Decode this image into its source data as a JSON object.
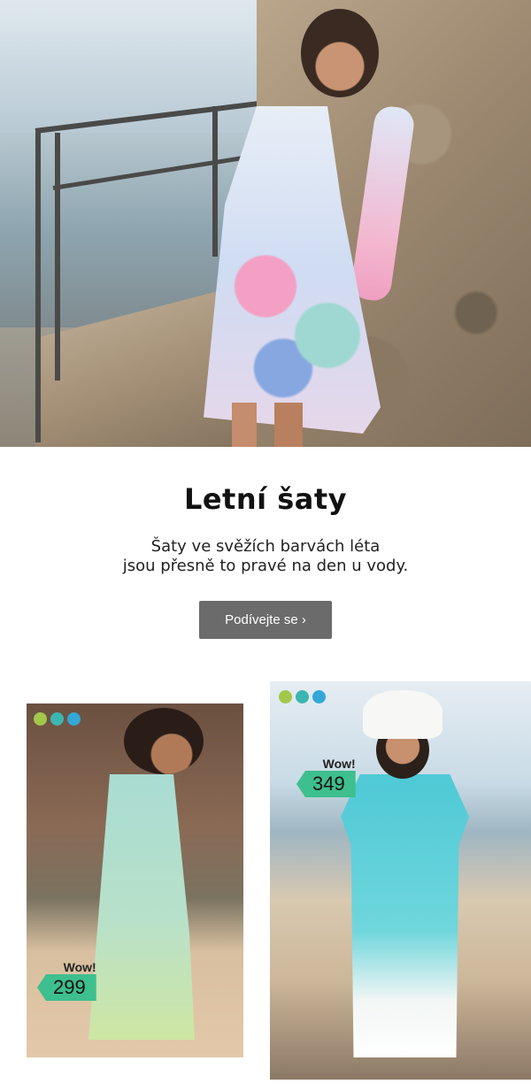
{
  "hero": {
    "alt": "Woman in pastel floral dress leaning on rock by the sea"
  },
  "content": {
    "headline": "Letní šaty",
    "subtext_line1": "Šaty ve svěžích barvách léta",
    "subtext_line2": "jsou přesně to pravé na den u vody.",
    "cta_label": "Podívejte se ›"
  },
  "products": [
    {
      "wow": "Wow!",
      "price": "299",
      "color_dots": [
        "#a2c84a",
        "#3cb6b0",
        "#33a7d8"
      ],
      "price_bg": "#3dbf8e"
    },
    {
      "wow": "Wow!",
      "price": "349",
      "color_dots": [
        "#a2c84a",
        "#3cb6b0",
        "#33a7d8"
      ],
      "price_bg": "#3dbf8e"
    }
  ],
  "colors": {
    "cta_bg": "#6b6b6b",
    "cta_text": "#ffffff",
    "price_tag": "#3dbf8e"
  }
}
